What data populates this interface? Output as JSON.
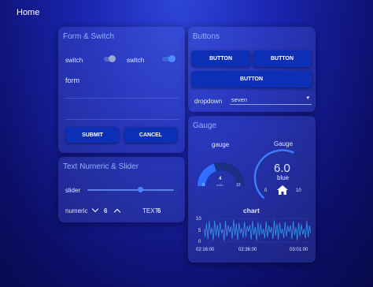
{
  "topbar": {
    "title": "Home"
  },
  "form_switch": {
    "title": "Form & Switch",
    "switch1_label": "switch",
    "switch2_label": "switch",
    "switch1_on": false,
    "switch2_on": true,
    "form_label": "form",
    "submit_label": "SUBMIT",
    "cancel_label": "CANCEL"
  },
  "text_numeric": {
    "title": "Text Numeric & Slider",
    "slider_label": "slider",
    "slider_value_fraction": 0.72,
    "numeric_label": "numeric",
    "numeric_value": "6",
    "text_label": "TEXT",
    "text_value": "6"
  },
  "buttons": {
    "title": "Buttons",
    "button1_label": "BUTTON",
    "button2_label": "BUTTON",
    "button3_label": "BUTTON",
    "dropdown_label": "dropdown",
    "dropdown_value": "seven"
  },
  "gauge": {
    "title": "Gauge",
    "gauge1": {
      "label": "gauge",
      "value": "4",
      "units": "units",
      "min": "0",
      "max": "10",
      "fraction": 0.4
    },
    "gauge2": {
      "label": "Gauge",
      "value": "6.0",
      "sublabel": "blue",
      "min": "0",
      "max": "10",
      "fraction": 0.6,
      "icon": "home-icon"
    },
    "chart_title": "chart"
  },
  "chart_data": {
    "type": "line",
    "title": "chart",
    "y_ticks": [
      "10",
      "5",
      "0"
    ],
    "x_ticks": [
      "02:16:00",
      "02:36:00",
      "03:01:00"
    ],
    "ylim": [
      0,
      10
    ],
    "series": [
      {
        "values": [
          5.8,
          2.1,
          7.9,
          1.2,
          8.8,
          3.4,
          6.1,
          0.8,
          9.1,
          2.7,
          7.4,
          1.9,
          8.3,
          3.9,
          5.2,
          0.6,
          8.9,
          2.4,
          7.1,
          4.1,
          6.6,
          1.4,
          9.3,
          2.9,
          7.7,
          0.9,
          8.1,
          3.6,
          5.9,
          1.8,
          8.6,
          2.2,
          6.8,
          4.4,
          7.3,
          1.1,
          9.0,
          3.1,
          6.3,
          0.7,
          8.4,
          2.6,
          7.6,
          3.3,
          5.6,
          1.5,
          8.7,
          2.0,
          7.0,
          4.0,
          6.4,
          1.3,
          9.2,
          2.8,
          7.8,
          1.0,
          8.2,
          3.5,
          5.7,
          1.7,
          8.5,
          2.3,
          6.9,
          4.2,
          7.2,
          1.2,
          8.8,
          3.0,
          6.2,
          0.8,
          8.3,
          2.5,
          7.5,
          3.2,
          5.5,
          1.6,
          8.9,
          2.1,
          7.0,
          3.8
        ]
      }
    ]
  },
  "colors": {
    "accent": "#3f7bff",
    "button": "#0d2fb5",
    "title": "#8fb0ff",
    "gauge_track": "#1b2f86"
  }
}
